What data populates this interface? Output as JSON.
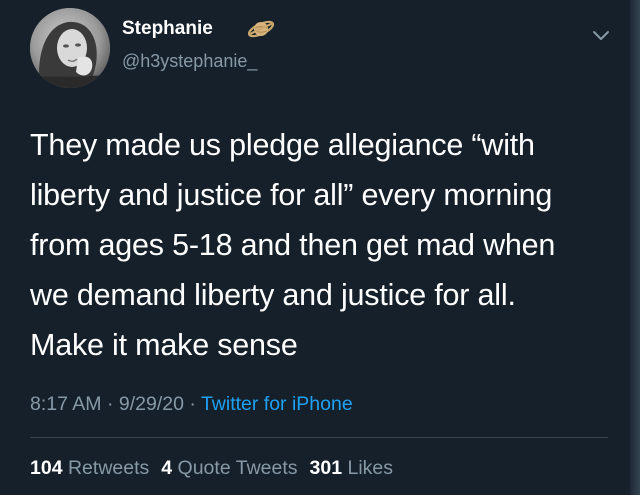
{
  "user": {
    "display_name": "Stephanie",
    "handle": "@h3ystephanie_",
    "badge_icon": "ringed-planet-icon"
  },
  "tweet": {
    "lines": [
      "They made us pledge allegiance “with",
      "liberty and justice for all” every morning",
      "from ages 5-18 and then get mad when",
      "we demand liberty and justice for all.",
      "Make it make sense"
    ]
  },
  "meta": {
    "time": "8:17 AM",
    "separator": " · ",
    "date": "9/29/20",
    "source": "Twitter for iPhone"
  },
  "stats": {
    "retweets_count": "104",
    "retweets_label": "Retweets",
    "quotes_count": "4",
    "quotes_label": "Quote Tweets",
    "likes_count": "301",
    "likes_label": "Likes"
  },
  "colors": {
    "background": "#15202b",
    "secondary_text": "#8899a6",
    "link": "#1da1f2",
    "divider": "#38444d"
  }
}
